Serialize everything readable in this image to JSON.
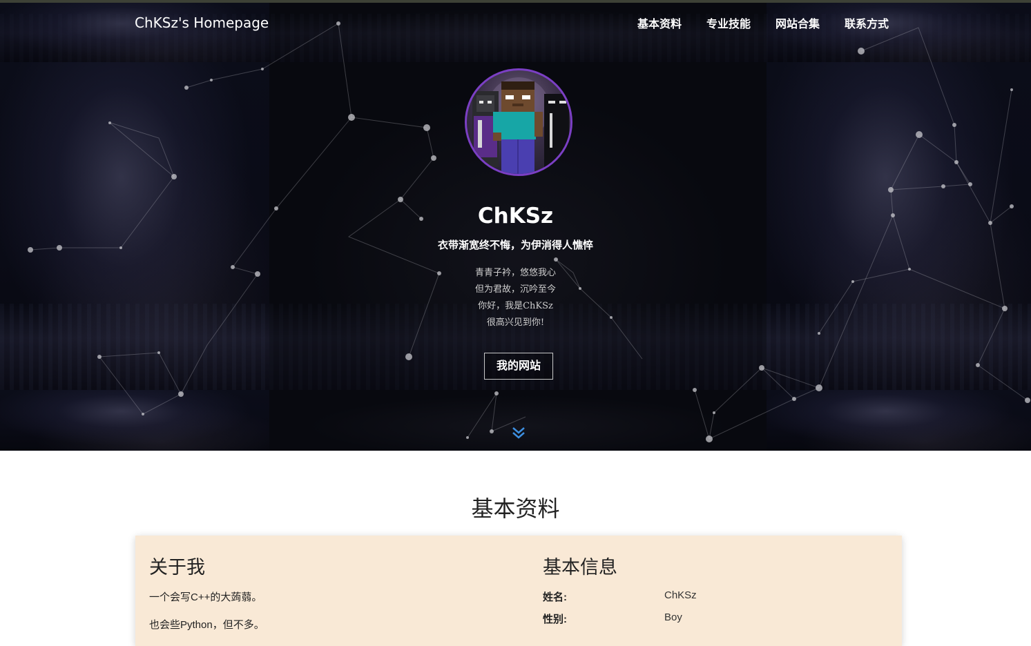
{
  "nav": {
    "brand": "ChKSz's Homepage",
    "items": [
      {
        "label": "基本资料"
      },
      {
        "label": "专业技能"
      },
      {
        "label": "网站合集"
      },
      {
        "label": "联系方式"
      }
    ]
  },
  "hero": {
    "name": "ChKSz",
    "motto": "衣带渐宽终不悔，为伊消得人憔悴",
    "poem": [
      "青青子衿，悠悠我心",
      "但为君故，沉吟至今",
      "你好，我是ChKSz",
      "很高兴见到你!"
    ],
    "button_label": "我的网站",
    "scroll_icon": "double-chevron-down-icon",
    "avatar_icon": "minecraft-avatar",
    "colors": {
      "avatar_border": "#7b3fc4",
      "scroll_arrow": "#3d8fe0"
    }
  },
  "section": {
    "title": "基本资料",
    "about": {
      "heading": "关于我",
      "lines": [
        "一个会写C++的大蒟蒻。",
        "也会些Python，但不多。"
      ]
    },
    "info": {
      "heading": "基本信息",
      "rows": [
        {
          "label": "姓名:",
          "value": "ChKSz"
        },
        {
          "label": "性别:",
          "value": "Boy"
        }
      ]
    },
    "colors": {
      "card_bg": "#f9e9d6"
    }
  }
}
